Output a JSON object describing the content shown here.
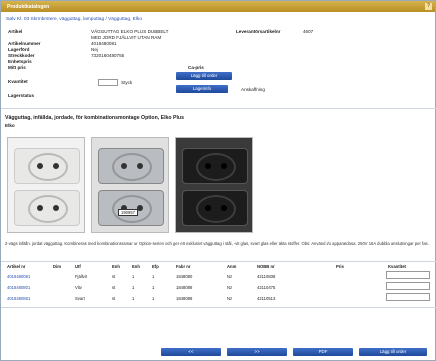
{
  "window": {
    "title": "Produktkatalogen",
    "help_label": "?"
  },
  "breadcrumb": "Sølv Kl. 03 Skrmbrstere, vägguttag, lamputtag / Vägguttag, Elko",
  "product": {
    "artikel_label": "Artikel",
    "artikel_value": "VÄGGUTTAG ELKO PLUS DUBBELT",
    "artikel_value_2": "MED JORD FJÄLLVIT UTAN RAM",
    "lev_label": "Leverantörsartikelnr",
    "lev_value": "4607",
    "artikelnummer_label": "Artikelnummer",
    "artikelnummer_value": "4018480081",
    "lagerford_label": "Lagerförd",
    "lagerford_value": "Nej",
    "streckkod_label": "Streckkoder",
    "streckkod_value": "7320160480755",
    "enhet_label": "Enhetspris",
    "mitt_pris_label": "Mitt pris",
    "kvantitet_label": "Kvantitet",
    "unit": "Styck",
    "ca_pris_label": "Ca-pris",
    "lagerstatus_label": "Lagerstatus",
    "lagg_till_label": "Lägg till order",
    "lagerinfo_label": "Lagerinfo",
    "anskaffning_label": "Anskaffning"
  },
  "heading": "Vägguttag, infällda, jordade, för kombinationsmontage Option, Elko Plus",
  "brand": "Elko",
  "image_tag": "190957",
  "description": "2-vägs infälln. jordat vägguttag. Kombineras med kombinationsramar ur Option-serien och ger ett exklusivt vägguttag i stål, -vit glas, svart glas eller äkta stoffer. Obs: Använd i/u apparatdosa. 250V 16A dubbla anslutningar per fas.",
  "table": {
    "headers": [
      "Artikel nr",
      "Dim",
      "Utf",
      "Enh",
      "Enh",
      "Efp",
      "Fabr nr",
      "Anm",
      "NOBB nr",
      "Pris",
      "Kvantitet"
    ],
    "rows": [
      {
        "artikel": "4018480081",
        "utf": "Fjällvit",
        "enh1": "st",
        "enh2": "1",
        "efp": "1",
        "fabr": "1848080",
        "anm": "Nz",
        "nobb": "42110838"
      },
      {
        "artikel": "4018480801",
        "utf": "Vitv",
        "enh1": "st",
        "enh2": "1",
        "efp": "1",
        "fabr": "1848088",
        "anm": "Nz",
        "nobb": "42110475"
      },
      {
        "artikel": "4018480881",
        "utf": "Svart",
        "enh1": "st",
        "enh2": "1",
        "efp": "1",
        "fabr": "1848088",
        "anm": "Nz",
        "nobb": "42110513"
      }
    ]
  },
  "footer": {
    "prev": "<<",
    "next": ">>",
    "pdf": "PDF",
    "order": "Lägg till order"
  }
}
